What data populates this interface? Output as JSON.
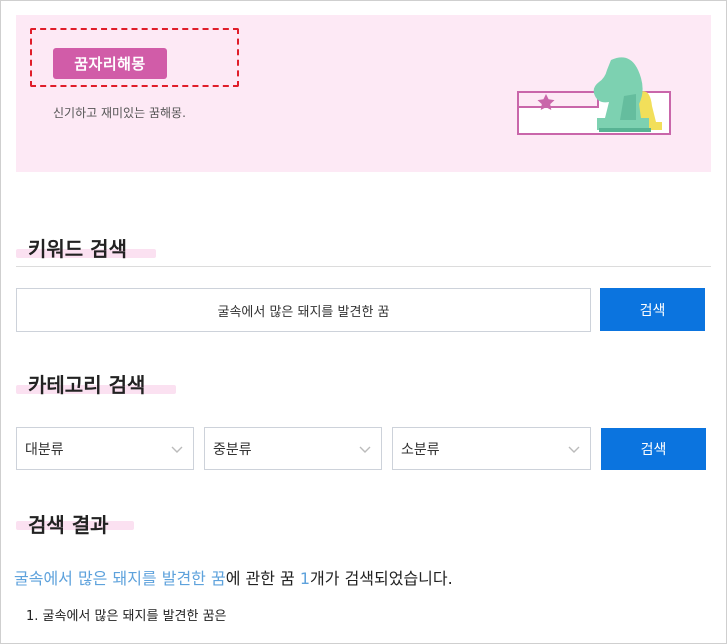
{
  "banner": {
    "badge_label": "꿈자리해몽",
    "subtitle": "신기하고 재미있는 꿈해몽."
  },
  "keyword_search": {
    "title": "키워드 검색",
    "input_value": "굴속에서 많은 돼지를 발견한 꿈",
    "button_label": "검색"
  },
  "category_search": {
    "title": "카테고리 검색",
    "selects": [
      {
        "selected": "대분류"
      },
      {
        "selected": "중분류"
      },
      {
        "selected": "소분류"
      }
    ],
    "button_label": "검색"
  },
  "results": {
    "title": "검색 결과",
    "query": "굴속에서 많은 돼지를 발견한 꿈",
    "text_mid": "에 관한 꿈 ",
    "count": "1",
    "text_end": "개가 검색되었습니다.",
    "items": [
      {
        "label": "1. 굴속에서 많은 돼지를 발견한 꿈은"
      }
    ]
  },
  "colors": {
    "accent_blue": "#0b74df",
    "banner_pink": "#fde9f5",
    "badge_pink": "#d15ca8",
    "highlight_blue": "#5ea2dc"
  }
}
